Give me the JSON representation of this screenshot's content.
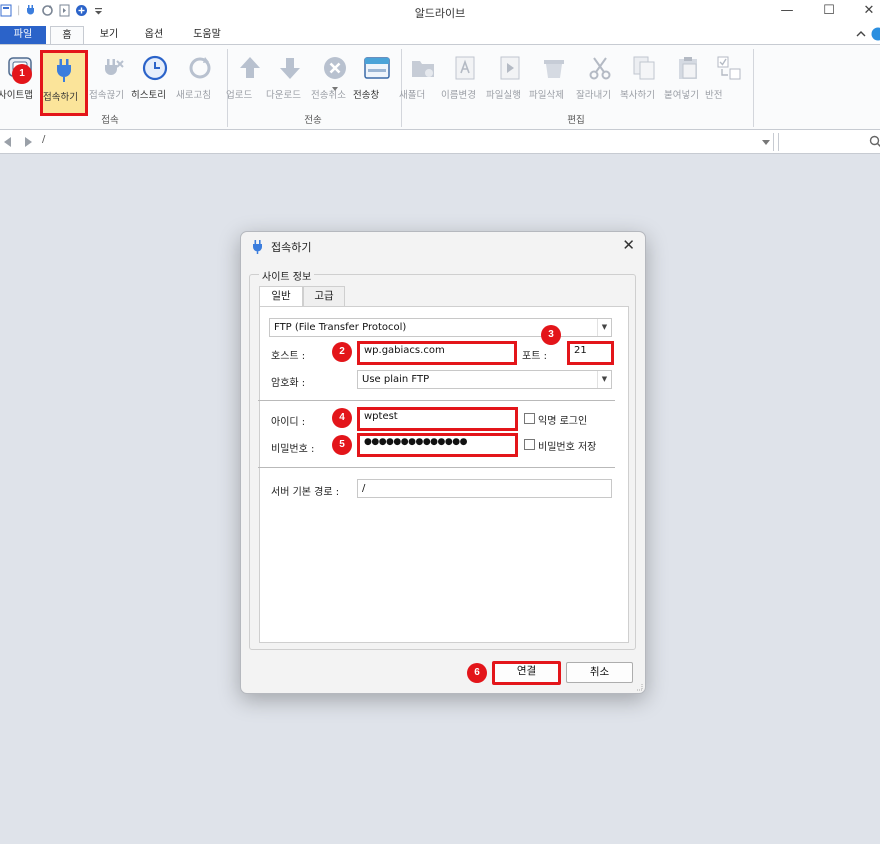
{
  "window": {
    "title": "알드라이브",
    "controls": {
      "minimize": "—",
      "maximize": "☐",
      "close": "✕"
    }
  },
  "menu": {
    "tabs": [
      {
        "label": "파일"
      },
      {
        "label": "홈"
      },
      {
        "label": "보기"
      },
      {
        "label": "옵션"
      },
      {
        "label": "도움말"
      }
    ]
  },
  "ribbon": {
    "groups": [
      {
        "label": "접속",
        "buttons": [
          {
            "label": "사이트맵",
            "icon": "sitemap-icon"
          },
          {
            "label": "접속하기",
            "icon": "plug-icon"
          },
          {
            "label": "접속끊기",
            "icon": "unplug-icon"
          },
          {
            "label": "히스토리",
            "icon": "clock-icon"
          },
          {
            "label": "새로고침",
            "icon": "refresh-icon"
          }
        ]
      },
      {
        "label": "전송",
        "buttons": [
          {
            "label": "업로드",
            "icon": "upload-icon"
          },
          {
            "label": "다운로드",
            "icon": "download-icon"
          },
          {
            "label": "전송취소",
            "icon": "cancel-icon"
          },
          {
            "label": "전송창",
            "icon": "window-icon"
          }
        ]
      },
      {
        "label": "편집",
        "buttons": [
          {
            "label": "새폴더",
            "icon": "new-folder-icon"
          },
          {
            "label": "이름변경",
            "icon": "rename-icon"
          },
          {
            "label": "파일실행",
            "icon": "run-file-icon"
          },
          {
            "label": "파일삭제",
            "icon": "delete-icon"
          },
          {
            "label": "잘라내기",
            "icon": "scissors-icon"
          },
          {
            "label": "복사하기",
            "icon": "copy-icon"
          },
          {
            "label": "붙여넣기",
            "icon": "paste-icon"
          },
          {
            "label": "반전",
            "icon": "invert-icon"
          }
        ]
      }
    ]
  },
  "address": {
    "path": "/"
  },
  "dialog": {
    "title": "접속하기",
    "close": "✕",
    "section_label": "사이트 정보",
    "tabs": [
      "일반",
      "고급"
    ],
    "protocol": "FTP (File Transfer Protocol)",
    "host_label": "호스트 :",
    "host": "wp.gabiacs.com",
    "port_label": "포트 :",
    "port": "21",
    "encryption_label": "암호화 :",
    "encryption": "Use plain FTP",
    "id_label": "아이디 :",
    "id": "wptest",
    "anonymous_label": "익명 로그인",
    "password_label": "비밀번호 :",
    "password": "●●●●●●●●●●●●●●",
    "save_password_label": "비밀번호 저장",
    "base_path_label": "서버 기본 경로 :",
    "base_path": "/",
    "connect_label": "연결",
    "cancel_label": "취소"
  },
  "annotations": [
    "1",
    "2",
    "3",
    "4",
    "5",
    "6"
  ],
  "colors": {
    "accent": "#2b63c9",
    "highlight": "#e3151a",
    "background": "#dfe3ea"
  }
}
